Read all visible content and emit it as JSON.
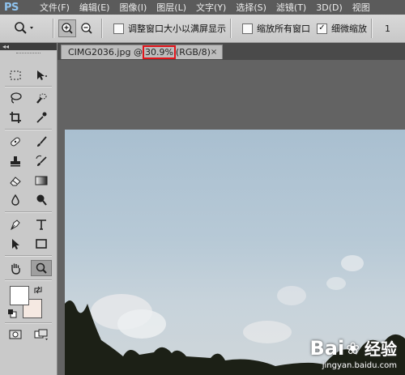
{
  "app": {
    "logo": "PS"
  },
  "menu": [
    "文件(F)",
    "编辑(E)",
    "图像(I)",
    "图层(L)",
    "文字(Y)",
    "选择(S)",
    "滤镜(T)",
    "3D(D)",
    "视图"
  ],
  "options": {
    "resize_windows": {
      "label": "调整窗口大小以满屏显示",
      "checked": false
    },
    "zoom_all_windows": {
      "label": "缩放所有窗口",
      "checked": false
    },
    "scrubby_zoom": {
      "label": "细微缩放",
      "checked": true
    },
    "extra_button": "1"
  },
  "panel": {
    "collapse_label": "◂◂"
  },
  "document": {
    "filename": "CIMG2036.jpg @",
    "zoom": "30.9%",
    "mode": "(RGB/8)",
    "close": "×"
  },
  "colors": {
    "foreground": "#ffffff",
    "background": "#f5e9e2",
    "highlight": "#e0141a"
  },
  "watermark": {
    "brand_a": "Bai",
    "brand_b": "经验",
    "url": "jingyan.baidu.com"
  }
}
